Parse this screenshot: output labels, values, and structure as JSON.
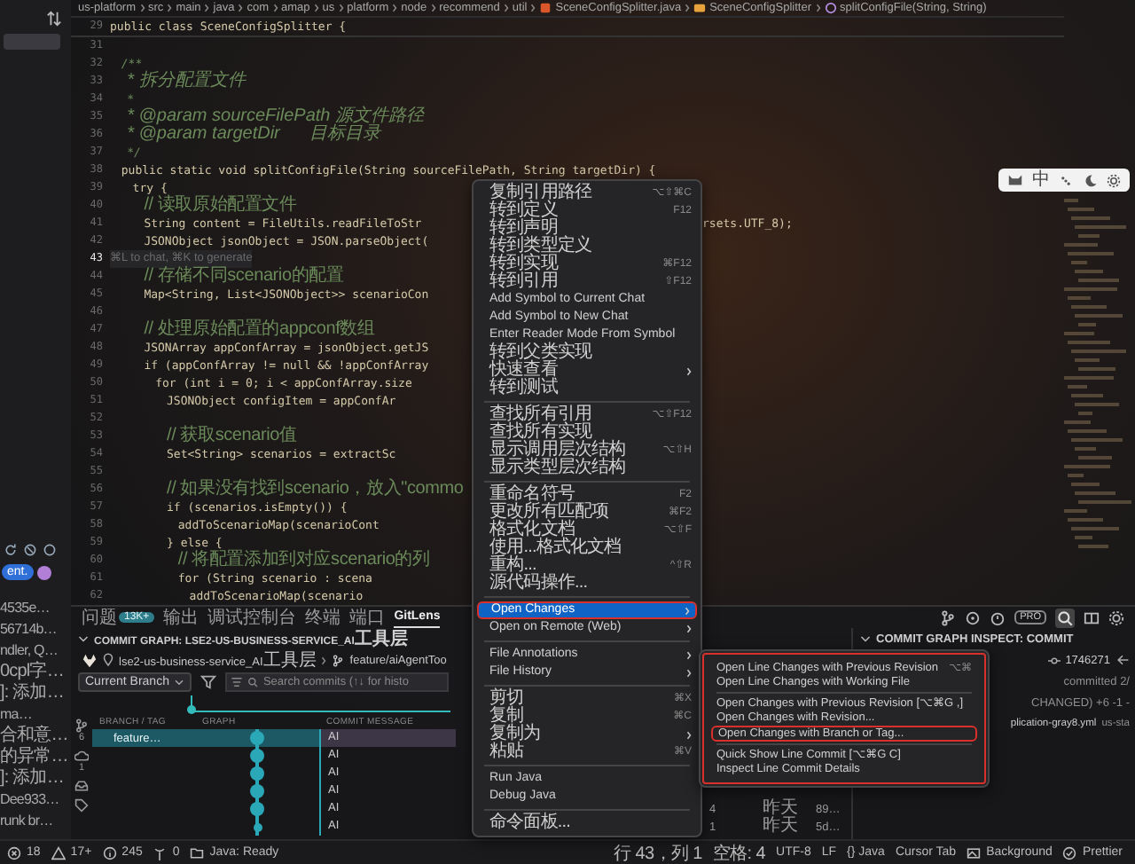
{
  "sidebar": {
    "pill": "ent.",
    "list": [
      "4535e…",
      "56714b…",
      "ndler, Q…",
      "0cpl字…",
      "]: 添加…",
      "ma…",
      "合和意…",
      "的异常…",
      "]: 添加…",
      "Dee933…",
      "runk br…"
    ]
  },
  "breadcrumb": [
    {
      "kind": "folder",
      "label": "us-platform"
    },
    {
      "kind": "folder",
      "label": "src"
    },
    {
      "kind": "folder",
      "label": "main"
    },
    {
      "kind": "folder",
      "label": "java"
    },
    {
      "kind": "folder",
      "label": "com"
    },
    {
      "kind": "folder",
      "label": "amap"
    },
    {
      "kind": "folder",
      "label": "us"
    },
    {
      "kind": "folder",
      "label": "platform"
    },
    {
      "kind": "folder",
      "label": "node"
    },
    {
      "kind": "folder",
      "label": "recommend"
    },
    {
      "kind": "folder",
      "label": "util"
    },
    {
      "kind": "file",
      "label": "SceneConfigSplitter.java"
    },
    {
      "kind": "class",
      "label": "SceneConfigSplitter"
    },
    {
      "kind": "method",
      "label": "splitConfigFile(String, String)"
    }
  ],
  "editor": {
    "sticky": {
      "number": "29",
      "text": "public class SceneConfigSplitter {"
    },
    "lines": [
      {
        "number": "31",
        "current": false
      },
      {
        "number": "32",
        "kind": "doc",
        "current": false,
        "text": "  /**"
      },
      {
        "number": "33",
        "kind": "doc",
        "current": false,
        "text": "   * 拆分配置文件"
      },
      {
        "number": "34",
        "kind": "doc",
        "current": false,
        "text": "   *"
      },
      {
        "number": "35",
        "kind": "doc",
        "current": false,
        "text": "   * @param sourceFilePath 源文件路径"
      },
      {
        "number": "36",
        "kind": "doc",
        "current": false,
        "text": "   * @param targetDir      目标目录"
      },
      {
        "number": "37",
        "kind": "doc",
        "current": false,
        "text": "   */"
      },
      {
        "number": "38",
        "kind": "code",
        "current": false,
        "text": "  public static void splitConfigFile(String sourceFilePath, String targetDir) {"
      },
      {
        "number": "39",
        "kind": "code",
        "current": false,
        "text": "    try {"
      },
      {
        "number": "40",
        "kind": "comment",
        "current": false,
        "text": "      // 读取原始配置文件"
      },
      {
        "number": "41",
        "kind": "code",
        "current": false,
        "text": "      String content = FileUtils.readFileToStr",
        "tail": "rsets.UTF_8);"
      },
      {
        "number": "42",
        "kind": "code",
        "current": false,
        "text": "      JSONObject jsonObject = JSON.parseObject("
      },
      {
        "number": "43",
        "kind": "hint",
        "current": true,
        "text": "⌘L to chat, ⌘K to generate"
      },
      {
        "number": "44",
        "kind": "comment",
        "current": false,
        "text": "      // 存储不同scenario的配置"
      },
      {
        "number": "45",
        "kind": "code",
        "current": false,
        "text": "      Map<String, List<JSONObject>> scenarioCon"
      },
      {
        "number": "46",
        "current": false
      },
      {
        "number": "47",
        "kind": "comment",
        "current": false,
        "text": "      // 处理原始配置的appconf数组"
      },
      {
        "number": "48",
        "kind": "code",
        "current": false,
        "text": "      JSONArray appConfArray = jsonObject.getJS"
      },
      {
        "number": "49",
        "kind": "code",
        "current": false,
        "text": "      if (appConfArray != null && !appConfArray"
      },
      {
        "number": "50",
        "kind": "code",
        "current": false,
        "text": "        for (int i = 0; i < appConfArray.size"
      },
      {
        "number": "51",
        "kind": "code",
        "current": false,
        "text": "          JSONObject configItem = appConfAr"
      },
      {
        "number": "52",
        "current": false
      },
      {
        "number": "53",
        "kind": "comment",
        "current": false,
        "text": "          // 获取scenario值"
      },
      {
        "number": "54",
        "kind": "code",
        "current": false,
        "text": "          Set<String> scenarios = extractSc"
      },
      {
        "number": "55",
        "current": false
      },
      {
        "number": "56",
        "kind": "comment",
        "current": false,
        "text": "          // 如果没有找到scenario，放入\"commo"
      },
      {
        "number": "57",
        "kind": "code",
        "current": false,
        "text": "          if (scenarios.isEmpty()) {"
      },
      {
        "number": "58",
        "kind": "code",
        "current": false,
        "text": "            addToScenarioMap(scenarioCont"
      },
      {
        "number": "59",
        "kind": "code",
        "current": false,
        "text": "          } else {"
      },
      {
        "number": "60",
        "kind": "comment",
        "current": false,
        "text": "            // 将配置添加到对应scenario的列"
      },
      {
        "number": "61",
        "kind": "code",
        "current": false,
        "text": "            for (String scenario : scena"
      },
      {
        "number": "62",
        "kind": "code",
        "current": false,
        "text": "              addToScenarioMap(scenario"
      }
    ]
  },
  "floating_toolbar": {
    "mode": "中"
  },
  "context_menu": {
    "items": [
      {
        "kind": "item",
        "label": "复制引用路径",
        "shortcut": "⌥⇧⌘C",
        "submenu": false,
        "selected": false,
        "outlined": false
      },
      {
        "kind": "item",
        "label": "转到定义",
        "shortcut": "F12",
        "submenu": false,
        "selected": false,
        "outlined": false
      },
      {
        "kind": "item",
        "label": "转到声明",
        "submenu": false,
        "selected": false,
        "outlined": false
      },
      {
        "kind": "item",
        "label": "转到类型定义",
        "submenu": false,
        "selected": false,
        "outlined": false
      },
      {
        "kind": "item",
        "label": "转到实现",
        "shortcut": "⌘F12",
        "submenu": false,
        "selected": false,
        "outlined": false
      },
      {
        "kind": "item",
        "label": "转到引用",
        "shortcut": "⇧F12",
        "submenu": false,
        "selected": false,
        "outlined": false
      },
      {
        "kind": "item",
        "label": "Add Symbol to Current Chat",
        "submenu": false,
        "selected": false,
        "outlined": false
      },
      {
        "kind": "item",
        "label": "Add Symbol to New Chat",
        "submenu": false,
        "selected": false,
        "outlined": false
      },
      {
        "kind": "item",
        "label": "Enter Reader Mode From Symbol",
        "submenu": false,
        "selected": false,
        "outlined": false
      },
      {
        "kind": "item",
        "label": "转到父类实现",
        "submenu": false,
        "selected": false,
        "outlined": false
      },
      {
        "kind": "item",
        "label": "快速查看",
        "submenu": true,
        "selected": false,
        "outlined": false
      },
      {
        "kind": "item",
        "label": "转到测试",
        "submenu": false,
        "selected": false,
        "outlined": false
      },
      {
        "kind": "separator"
      },
      {
        "kind": "item",
        "label": "查找所有引用",
        "shortcut": "⌥⇧F12",
        "submenu": false,
        "selected": false,
        "outlined": false
      },
      {
        "kind": "item",
        "label": "查找所有实现",
        "submenu": false,
        "selected": false,
        "outlined": false
      },
      {
        "kind": "item",
        "label": "显示调用层次结构",
        "shortcut": "⌥⇧H",
        "submenu": false,
        "selected": false,
        "outlined": false
      },
      {
        "kind": "item",
        "label": "显示类型层次结构",
        "submenu": false,
        "selected": false,
        "outlined": false
      },
      {
        "kind": "separator"
      },
      {
        "kind": "item",
        "label": "重命名符号",
        "shortcut": "F2",
        "submenu": false,
        "selected": false,
        "outlined": false
      },
      {
        "kind": "item",
        "label": "更改所有匹配项",
        "shortcut": "⌘F2",
        "submenu": false,
        "selected": false,
        "outlined": false
      },
      {
        "kind": "item",
        "label": "格式化文档",
        "shortcut": "⌥⇧F",
        "submenu": false,
        "selected": false,
        "outlined": false
      },
      {
        "kind": "item",
        "label": "使用...格式化文档",
        "submenu": false,
        "selected": false,
        "outlined": false
      },
      {
        "kind": "item",
        "label": "重构...",
        "shortcut": "^⇧R",
        "submenu": false,
        "selected": false,
        "outlined": false
      },
      {
        "kind": "item",
        "label": "源代码操作...",
        "submenu": false,
        "selected": false,
        "outlined": false
      },
      {
        "kind": "separator"
      },
      {
        "kind": "item",
        "label": "Open Changes",
        "submenu": true,
        "selected": true,
        "outlined": true
      },
      {
        "kind": "item",
        "label": "Open on Remote (Web)",
        "submenu": true,
        "selected": false,
        "outlined": false
      },
      {
        "kind": "separator"
      },
      {
        "kind": "item",
        "label": "File Annotations",
        "submenu": true,
        "selected": false,
        "outlined": false
      },
      {
        "kind": "item",
        "label": "File History",
        "submenu": true,
        "selected": false,
        "outlined": false
      },
      {
        "kind": "separator"
      },
      {
        "kind": "item",
        "label": "剪切",
        "shortcut": "⌘X",
        "submenu": false,
        "selected": false,
        "outlined": false
      },
      {
        "kind": "item",
        "label": "复制",
        "shortcut": "⌘C",
        "submenu": false,
        "selected": false,
        "outlined": false
      },
      {
        "kind": "item",
        "label": "复制为",
        "submenu": true,
        "selected": false,
        "outlined": false
      },
      {
        "kind": "item",
        "label": "粘贴",
        "shortcut": "⌘V",
        "submenu": false,
        "selected": false,
        "outlined": false
      },
      {
        "kind": "separator"
      },
      {
        "kind": "item",
        "label": "Run Java",
        "submenu": false,
        "selected": false,
        "outlined": false
      },
      {
        "kind": "item",
        "label": "Debug Java",
        "submenu": false,
        "selected": false,
        "outlined": false
      },
      {
        "kind": "separator"
      },
      {
        "kind": "item",
        "label": "命令面板...",
        "submenu": false,
        "selected": false,
        "outlined": false
      }
    ]
  },
  "submenu": {
    "outlined": true,
    "items": [
      {
        "kind": "item",
        "label": "Open Line Changes with Previous Revision",
        "shortcut": "⌥⌘",
        "outlined": false
      },
      {
        "kind": "item",
        "label": "Open Line Changes with Working File",
        "outlined": false
      },
      {
        "kind": "separator"
      },
      {
        "kind": "item",
        "label": "Open Changes with Previous Revision [⌥⌘G ,]",
        "outlined": false
      },
      {
        "kind": "item",
        "label": "Open Changes with Revision...",
        "outlined": false
      },
      {
        "kind": "item",
        "label": "Open Changes with Branch or Tag...",
        "outlined": true
      },
      {
        "kind": "separator"
      },
      {
        "kind": "item",
        "label": "Quick Show Line Commit [⌥⌘G C]",
        "outlined": false
      },
      {
        "kind": "item",
        "label": "Inspect Line Commit Details",
        "outlined": false
      }
    ]
  },
  "panel": {
    "tabs": [
      {
        "label": "问题",
        "badge": "13K+",
        "selected": false
      },
      {
        "label": "输出",
        "selected": false
      },
      {
        "label": "调试控制台",
        "selected": false
      },
      {
        "label": "终端",
        "selected": false
      },
      {
        "label": "端口",
        "selected": false
      },
      {
        "label": "GitLens",
        "selected": true
      }
    ],
    "graph": {
      "title": "COMMIT GRAPH: LSE2-US-BUSINESS-SERVICE_AI工具层",
      "repo": "lse2-us-business-service_AI工具层",
      "branch": "feature/aiAgentToo",
      "branch_filter": "Current Branch",
      "search_placeholder": "Search commits (↑↓ for histo",
      "pro_badge": "PRO",
      "columns": [
        "BRANCH / TAG",
        "GRAPH",
        "COMMIT MESSAGE"
      ],
      "strip": [
        {
          "kind": "branches",
          "count": "6"
        },
        {
          "kind": "remotes",
          "count": "1"
        },
        {
          "kind": "stashes"
        },
        {
          "kind": "tags"
        }
      ],
      "rows": [
        {
          "selected": true,
          "branch": "feature…",
          "kind": "avatar",
          "message": "AI"
        },
        {
          "selected": false,
          "kind": "avatar",
          "message": "AI"
        },
        {
          "selected": false,
          "kind": "avatar",
          "message": "AI"
        },
        {
          "selected": false,
          "kind": "avatar",
          "message": "AI"
        },
        {
          "selected": false,
          "kind": "avatar",
          "message": "AI",
          "changes": "4",
          "date": "昨天",
          "sha": "89…"
        },
        {
          "selected": false,
          "kind": "dot",
          "message": "AI",
          "changes": "1",
          "date": "昨天",
          "sha": "5d…"
        }
      ]
    },
    "inspect": {
      "title": "COMMIT GRAPH INSPECT: COMMIT",
      "sha": "1746271",
      "committed": "committed 2/",
      "changed": "CHANGED) +6 -1 -",
      "file_name": "plication-gray8.yml",
      "file_path": "us-sta"
    }
  },
  "status_bar": {
    "errors": "18",
    "warnings": "17+",
    "infos": "245",
    "ports": "0",
    "java": "Java: Ready",
    "right": [
      {
        "kind": "text",
        "label": "行 43，列 1"
      },
      {
        "kind": "text",
        "label": "空格: 4"
      },
      {
        "kind": "text",
        "label": "UTF-8"
      },
      {
        "kind": "text",
        "label": "LF"
      },
      {
        "kind": "text",
        "label": "{} Java"
      },
      {
        "kind": "text",
        "label": "Cursor Tab"
      },
      {
        "kind": "image",
        "label": "Background"
      },
      {
        "kind": "check",
        "label": "Prettier"
      }
    ]
  }
}
